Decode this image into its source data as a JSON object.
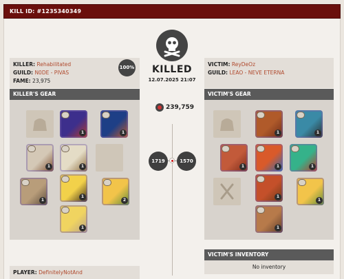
{
  "kill_id": "KILL ID: #1235340349",
  "center": {
    "status": "KILLED",
    "datetime": "12.07.2025 21:07",
    "total_fame": "239,759",
    "killer_ip": "1719",
    "victim_ip": "1570"
  },
  "killer": {
    "label_killer": "KILLER:",
    "name": "Rehabilitated",
    "label_guild": "GUILD:",
    "guild": "N0DE - PIVAS",
    "label_fame": "FAME:",
    "fame": "23,975",
    "percent": "100%",
    "gear_title": "KILLER'S GEAR"
  },
  "victim": {
    "label_victim": "VICTIM:",
    "name": "ReyDeOz",
    "label_guild": "GUILD:",
    "guild": "LEAO - NEVE ETERNA",
    "gear_title": "VICTIM'S GEAR",
    "inventory_title": "VICTIM'S INVENTORY",
    "inventory_empty": "No inventory"
  },
  "player": {
    "label": "PLAYER:",
    "name": "DefinitelyNotAnd"
  },
  "killer_gear": [
    {
      "slot": "bag",
      "empty": true,
      "icon": "bag-icon"
    },
    {
      "slot": "head",
      "item": "assassin hood",
      "qty": "1",
      "colors": [
        "#3d2f8c",
        "#b83a2a"
      ]
    },
    {
      "slot": "cape",
      "item": "faction cape",
      "qty": "1",
      "colors": [
        "#1e3f86",
        "#c55a2a"
      ]
    },
    {
      "slot": "mainhand",
      "item": "crossbow",
      "qty": "1",
      "colors": [
        "#d4c8b6",
        "#7b4a2a"
      ]
    },
    {
      "slot": "armor",
      "item": "cleric robe",
      "qty": "1",
      "colors": [
        "#e4dcc6",
        "#8b6a3a"
      ]
    },
    {
      "slot": "offhand",
      "empty": true,
      "icon": "offhand-icon"
    },
    {
      "slot": "potion",
      "item": "pot",
      "qty": "1",
      "colors": [
        "#b89d7a",
        "#5a4a3a"
      ]
    },
    {
      "slot": "shoes",
      "item": "boots",
      "qty": "1",
      "colors": [
        "#f2d14a",
        "#3a2a1a"
      ]
    },
    {
      "slot": "food",
      "item": "food",
      "qty": "2",
      "colors": [
        "#f2c44a",
        "#5c8a3a"
      ]
    },
    {
      "slot": "mount",
      "item": "mount",
      "qty": "1",
      "colors": [
        "#f0d460",
        "#b7a08a"
      ]
    }
  ],
  "victim_gear": [
    {
      "slot": "bag",
      "empty": true,
      "icon": "bag-icon"
    },
    {
      "slot": "head",
      "item": "helmet",
      "qty": "1",
      "colors": [
        "#b05a2a",
        "#6b2b1a"
      ]
    },
    {
      "slot": "cape",
      "item": "cape",
      "qty": "1",
      "colors": [
        "#3a8aa6",
        "#2a2a2a"
      ]
    },
    {
      "slot": "mainhand",
      "item": "spear",
      "qty": "1",
      "colors": [
        "#c25a3a",
        "#7b2a1a"
      ]
    },
    {
      "slot": "armor",
      "item": "armor",
      "qty": "1",
      "colors": [
        "#d95a2a",
        "#2e6ab4"
      ]
    },
    {
      "slot": "offhand",
      "item": "orb",
      "qty": "1",
      "colors": [
        "#35b28a",
        "#c03a2a"
      ]
    },
    {
      "slot": "potion",
      "empty": true,
      "icon": "food-icon"
    },
    {
      "slot": "shoes",
      "item": "boots",
      "qty": "1",
      "colors": [
        "#c4502a",
        "#6b3a1a"
      ]
    },
    {
      "slot": "food",
      "item": "food",
      "qty": "1",
      "colors": [
        "#f2c44a",
        "#5c8a3a"
      ]
    },
    {
      "slot": "mount",
      "item": "horse",
      "qty": "1",
      "colors": [
        "#b77a4a",
        "#5a3a2a"
      ]
    }
  ]
}
